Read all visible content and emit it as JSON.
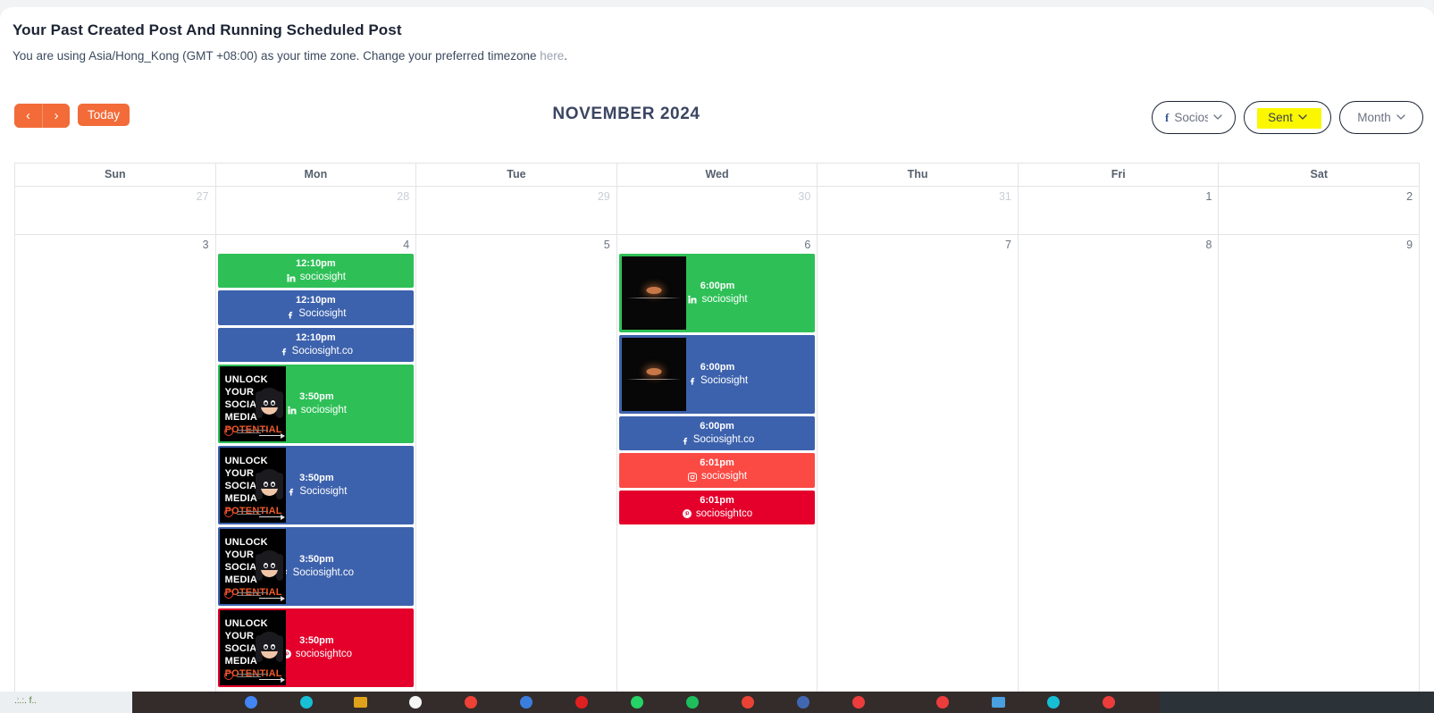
{
  "page": {
    "title": "Your Past Created Post And Running Scheduled Post",
    "timezone_note_prefix": "You are using Asia/Hong_Kong (GMT +08:00) as your time zone. Change your preferred timezone ",
    "timezone_link": "here",
    "timezone_note_suffix": "."
  },
  "toolbar": {
    "prev_label": "‹",
    "next_label": "›",
    "today_label": "Today",
    "calendar_title": "NOVEMBER 2024",
    "account_filter": "Sociosi",
    "status_filter": "Sent",
    "view_filter": "Month",
    "chevron": "⌄"
  },
  "colors": {
    "accent_orange": "#f26b38",
    "title_navy": "#3b4562",
    "highlight_yellow": "#faf700",
    "linkedin_green": "#2ec057",
    "facebook_blue": "#3d62ad",
    "instagram_red": "#fb4a44",
    "pinterest_red": "#e4002b"
  },
  "calendar": {
    "day_headers": [
      "Sun",
      "Mon",
      "Tue",
      "Wed",
      "Thu",
      "Fri",
      "Sat"
    ],
    "weeks": [
      {
        "days": [
          {
            "num": "27",
            "month": "other",
            "events": []
          },
          {
            "num": "28",
            "month": "other",
            "events": []
          },
          {
            "num": "29",
            "month": "other",
            "events": []
          },
          {
            "num": "30",
            "month": "other",
            "events": []
          },
          {
            "num": "31",
            "month": "other",
            "events": []
          },
          {
            "num": "1",
            "month": "current",
            "events": []
          },
          {
            "num": "2",
            "month": "current",
            "events": []
          }
        ]
      },
      {
        "days": [
          {
            "num": "3",
            "month": "current",
            "events": []
          },
          {
            "num": "4",
            "month": "current",
            "events": [
              {
                "time": "12:10pm",
                "account": "sociosight",
                "network": "linkedin",
                "color": "#2ec057",
                "thumb": "none"
              },
              {
                "time": "12:10pm",
                "account": "Sociosight",
                "network": "facebook",
                "color": "#3d62ad",
                "thumb": "none"
              },
              {
                "time": "12:10pm",
                "account": "Sociosight.co",
                "network": "facebook",
                "color": "#3d62ad",
                "thumb": "none"
              },
              {
                "time": "3:50pm",
                "account": "sociosight",
                "network": "linkedin",
                "color": "#2ec057",
                "thumb": "poster"
              },
              {
                "time": "3:50pm",
                "account": "Sociosight",
                "network": "facebook",
                "color": "#3d62ad",
                "thumb": "poster"
              },
              {
                "time": "3:50pm",
                "account": "Sociosight.co",
                "network": "facebook",
                "color": "#3d62ad",
                "thumb": "poster"
              },
              {
                "time": "3:50pm",
                "account": "sociosightco",
                "network": "pinterest",
                "color": "#e4002b",
                "thumb": "poster"
              }
            ]
          },
          {
            "num": "5",
            "month": "current",
            "events": []
          },
          {
            "num": "6",
            "month": "current",
            "events": [
              {
                "time": "6:00pm",
                "account": "sociosight",
                "network": "linkedin",
                "color": "#2ec057",
                "thumb": "photo"
              },
              {
                "time": "6:00pm",
                "account": "Sociosight",
                "network": "facebook",
                "color": "#3d62ad",
                "thumb": "photo"
              },
              {
                "time": "6:00pm",
                "account": "Sociosight.co",
                "network": "facebook",
                "color": "#3d62ad",
                "thumb": "none"
              },
              {
                "time": "6:01pm",
                "account": "sociosight",
                "network": "instagram",
                "color": "#fb4a44",
                "thumb": "none"
              },
              {
                "time": "6:01pm",
                "account": "sociosightco",
                "network": "pinterest",
                "color": "#e4002b",
                "thumb": "none"
              }
            ]
          },
          {
            "num": "7",
            "month": "current",
            "events": []
          },
          {
            "num": "8",
            "month": "current",
            "events": []
          },
          {
            "num": "9",
            "month": "current",
            "events": []
          }
        ]
      }
    ]
  },
  "poster": {
    "line1": "UNLOCK",
    "line2": "YOUR",
    "line3": "SOCIAL",
    "line4": "MEDIA",
    "line5": "POTENTIAL"
  }
}
